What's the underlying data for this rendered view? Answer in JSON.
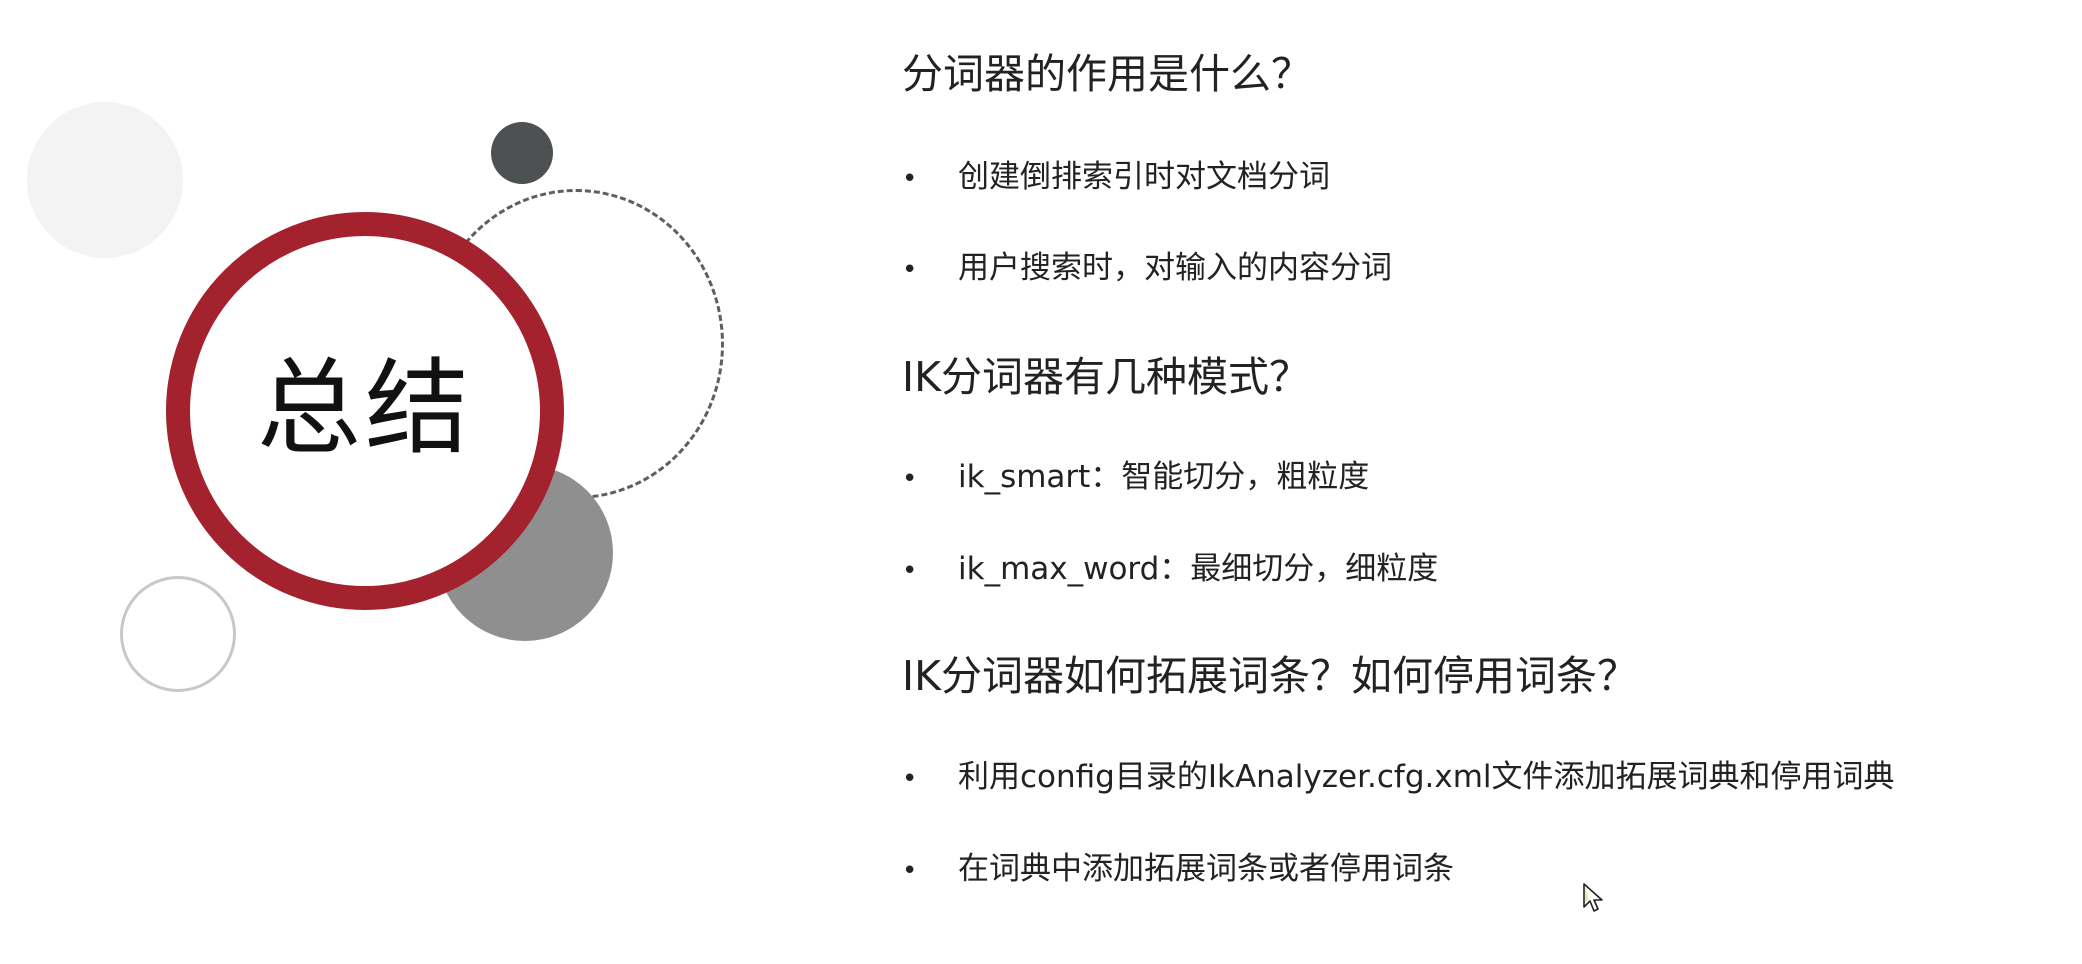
{
  "slide": {
    "badge_text": "总结",
    "sections": [
      {
        "question": "分词器的作用是什么？",
        "items": [
          "创建倒排索引时对文档分词",
          "用户搜索时，对输入的内容分词"
        ]
      },
      {
        "question": "IK分词器有几种模式？",
        "items": [
          "ik_smart：智能切分，粗粒度",
          "ik_max_word：最细切分，细粒度"
        ]
      },
      {
        "question": "IK分词器如何拓展词条？如何停用词条？",
        "items": [
          "利用config目录的IkAnalyzer.cfg.xml文件添加拓展词典和停用词典",
          "在词典中添加拓展词条或者停用词条"
        ]
      }
    ],
    "bullet_char": "•"
  },
  "colors": {
    "accent_red": "#a3222d",
    "dark_gray": "#4d5151",
    "mid_gray": "#8f8f8f",
    "light_gray": "#f3f3f3",
    "text": "#222222"
  },
  "icons": {
    "cursor": "mouse-pointer-icon"
  }
}
